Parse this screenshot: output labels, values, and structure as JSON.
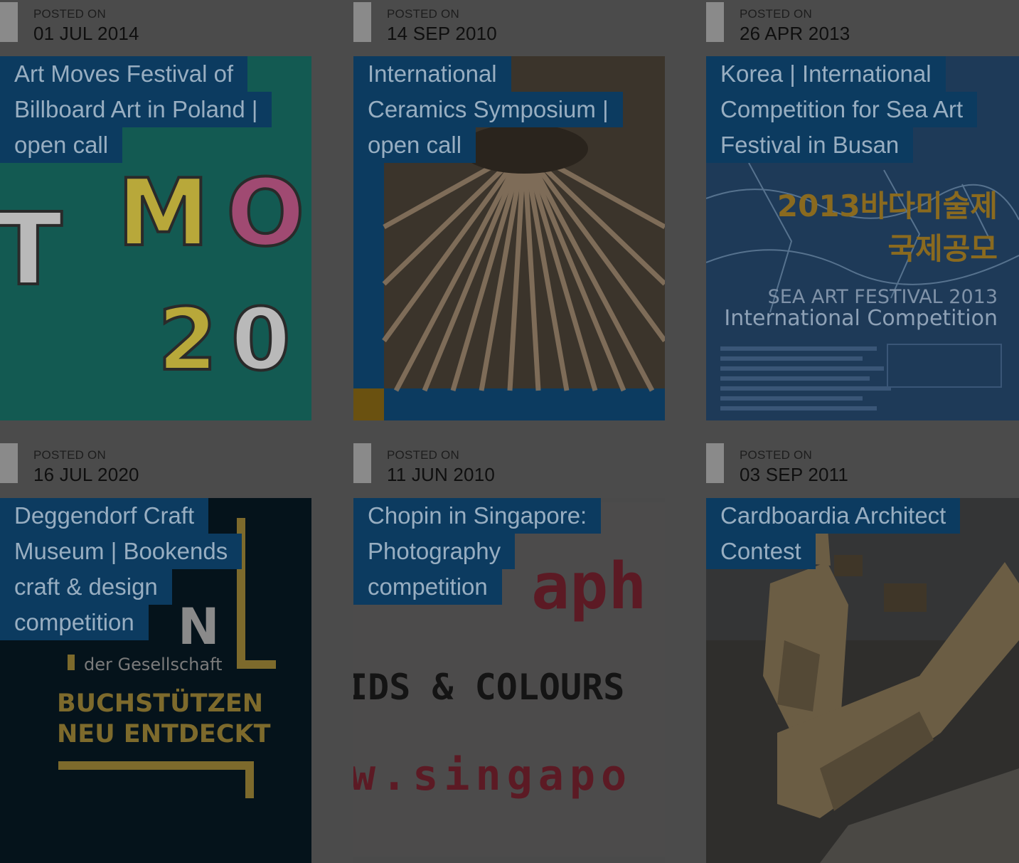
{
  "posted_label": "POSTED ON",
  "cards": [
    {
      "date": "01 JUL 2014",
      "title_lines": [
        "Art Moves Festival of",
        "Billboard Art in Poland |",
        "open call"
      ],
      "image_text": [
        "T",
        "M",
        "O",
        "2",
        "0"
      ]
    },
    {
      "date": "14 SEP 2010",
      "title_lines": [
        "International",
        "Ceramics Symposium |",
        "open call"
      ]
    },
    {
      "date": "26 APR 2013",
      "title_lines": [
        "Korea | International",
        "Competition for Sea Art",
        "Festival in Busan"
      ],
      "image_text": [
        "2013바다미술제",
        "국제공모",
        "SEA ART FESTIVAL 2013",
        "International Competition"
      ]
    },
    {
      "date": "16 JUL 2020",
      "title_lines": [
        "Deggendorf Craft",
        "Museum | Bookends",
        "craft & design",
        "competition"
      ],
      "image_text": [
        "der Gesellschaft",
        "BUCHSTÜTZEN",
        "NEU ENTDECKT",
        "N"
      ]
    },
    {
      "date": "11 JUN 2010",
      "title_lines": [
        "Chopin in Singapore:",
        "Photography",
        "competition"
      ],
      "image_text": [
        "aph",
        "IDS & COLOURS",
        "w.singapo"
      ]
    },
    {
      "date": "03 SEP 2011",
      "title_lines": [
        "Cardboardia Architect",
        "Contest"
      ]
    }
  ]
}
